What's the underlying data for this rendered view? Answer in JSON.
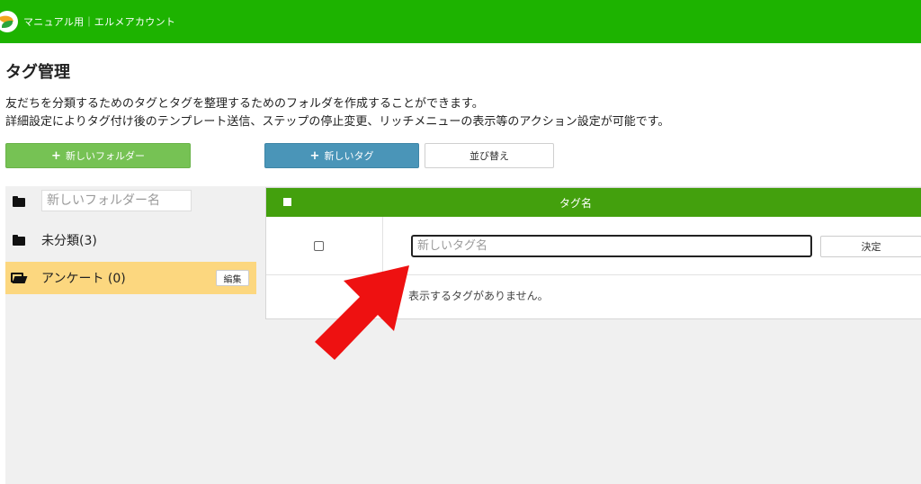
{
  "header": {
    "account_name": "マニュアル用｜エルメアカウント",
    "bar_color": "#1db300"
  },
  "page": {
    "title": "タグ管理",
    "description_line1": "友だちを分類するためのタグとタグを整理するためのフォルダを作成することができます。",
    "description_line2": "詳細設定によりタグ付け後のテンプレート送信、ステップの停止変更、リッチメニューの表示等のアクション設定が可能です。"
  },
  "toolbar": {
    "new_folder_label": "新しいフォルダー",
    "new_tag_label": "新しいタグ",
    "sort_label": "並び替え"
  },
  "folders": {
    "new_folder_placeholder": "新しいフォルダー名",
    "items": [
      {
        "label": "未分類(3)",
        "icon": "folder-icon"
      },
      {
        "label": "アンケート (0)",
        "icon": "folder-open-icon",
        "selected": true,
        "edit_label": "編集"
      }
    ],
    "selected_color": "#fcd77f"
  },
  "tag_table": {
    "header_label": "タグ名",
    "header_color": "#43a00d",
    "new_tag_placeholder": "新しいタグ名",
    "decide_label": "決定",
    "empty_message": "表示するタグがありません。"
  },
  "annotation": {
    "arrow_color": "#ee1111",
    "icon": "red-arrow-icon"
  }
}
